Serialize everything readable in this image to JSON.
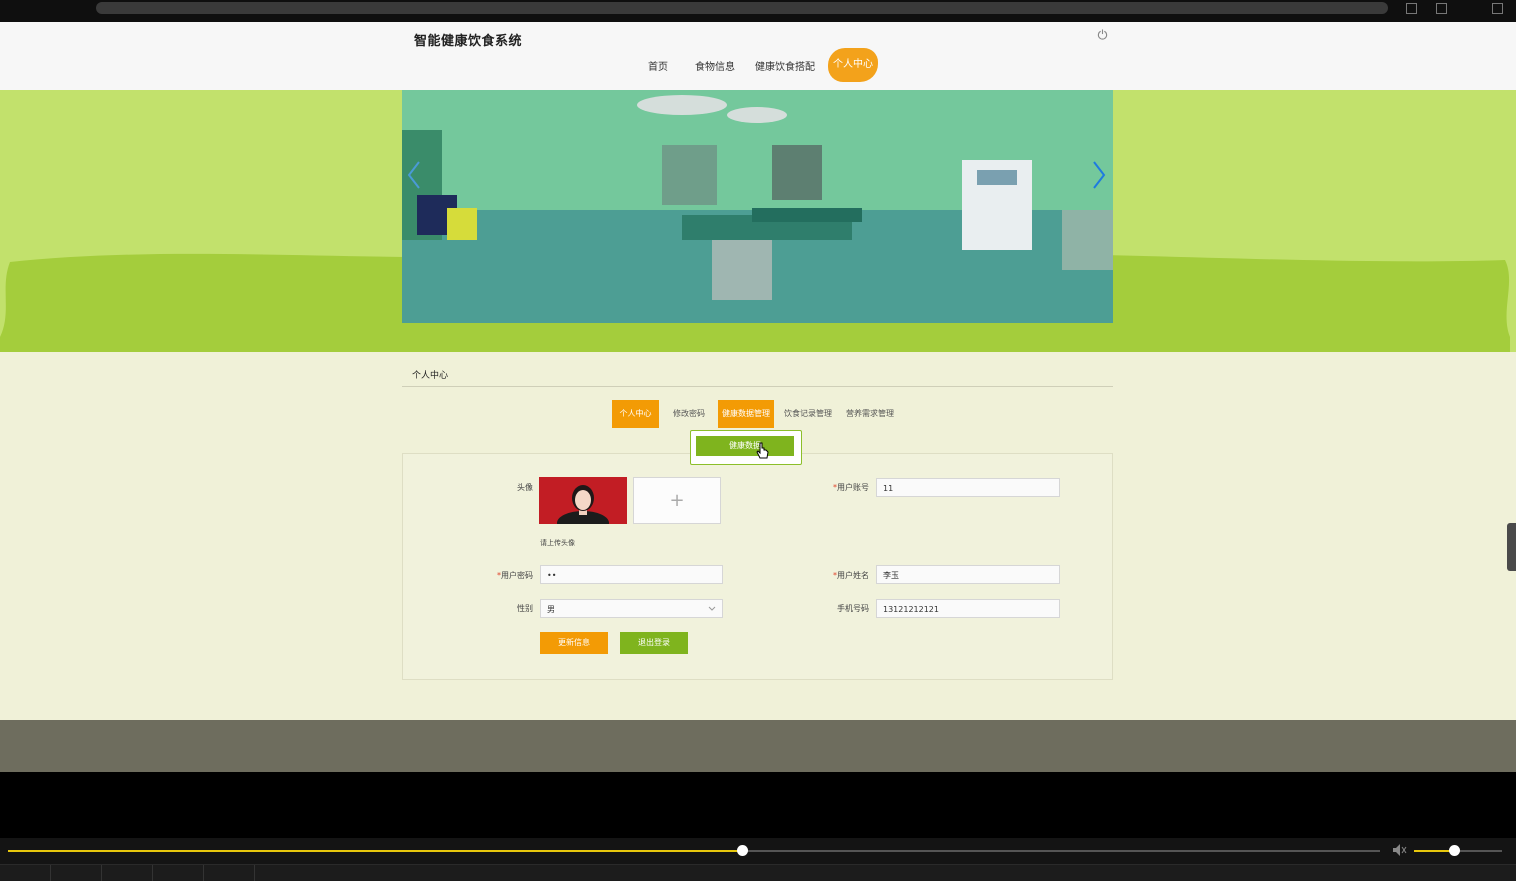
{
  "site": {
    "title": "智能健康饮食系统"
  },
  "nav": {
    "home": "首页",
    "food": "食物信息",
    "diet": "健康饮食搭配",
    "center": "个人中心"
  },
  "section": {
    "title": "个人中心"
  },
  "tabs": [
    "个人中心",
    "修改密码",
    "健康数据管理",
    "饮食记录管理",
    "营养需求管理"
  ],
  "dropdown": {
    "item": "健康数据"
  },
  "form": {
    "avatar_label": "头像",
    "upload_hint": "请上传头像",
    "upload_plus": "+",
    "account_label": "用户账号",
    "account_value": "11",
    "password_label": "用户密码",
    "password_value": "••",
    "name_label": "用户姓名",
    "name_value": "李玉",
    "gender_label": "性别",
    "gender_value": "男",
    "phone_label": "手机号码",
    "phone_value": "13121212121",
    "required_mark": "*"
  },
  "buttons": {
    "update": "更新信息",
    "logout": "退出登录"
  },
  "player": {
    "progress": 0.535,
    "volume": 0.45
  },
  "colors": {
    "accent": "#f39b05",
    "green": "#7fb41e",
    "banner": "#c2e16c",
    "page_bg": "#f0f1d8"
  }
}
